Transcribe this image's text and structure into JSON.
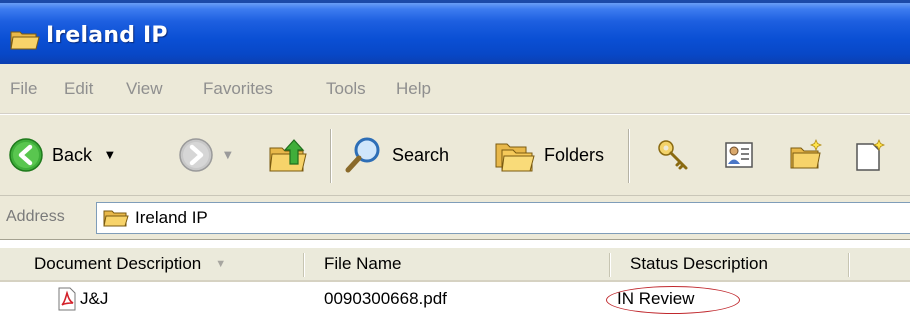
{
  "window": {
    "title": "Ireland IP",
    "icon": "folder-open-icon"
  },
  "menu": {
    "items": [
      "File",
      "Edit",
      "View",
      "Favorites",
      "Tools",
      "Help"
    ]
  },
  "toolbar": {
    "back_label": "Back",
    "search_label": "Search",
    "folders_label": "Folders",
    "icons": [
      "back-icon",
      "forward-icon",
      "up-folder-icon",
      "search-icon",
      "folders-icon",
      "key-icon",
      "properties-icon",
      "new-folder-icon",
      "new-document-icon"
    ]
  },
  "address": {
    "label": "Address",
    "value": "Ireland IP"
  },
  "table": {
    "columns": [
      "Document Description",
      "File Name",
      "Status Description"
    ],
    "rows": [
      {
        "description": "J&J",
        "file_name": "0090300668.pdf",
        "status": "IN Review",
        "icon": "pdf-file-icon"
      }
    ]
  },
  "colors": {
    "title_bar": "#0a4fd4",
    "chrome": "#ece9d8",
    "highlight_ellipse": "#c0282d"
  }
}
